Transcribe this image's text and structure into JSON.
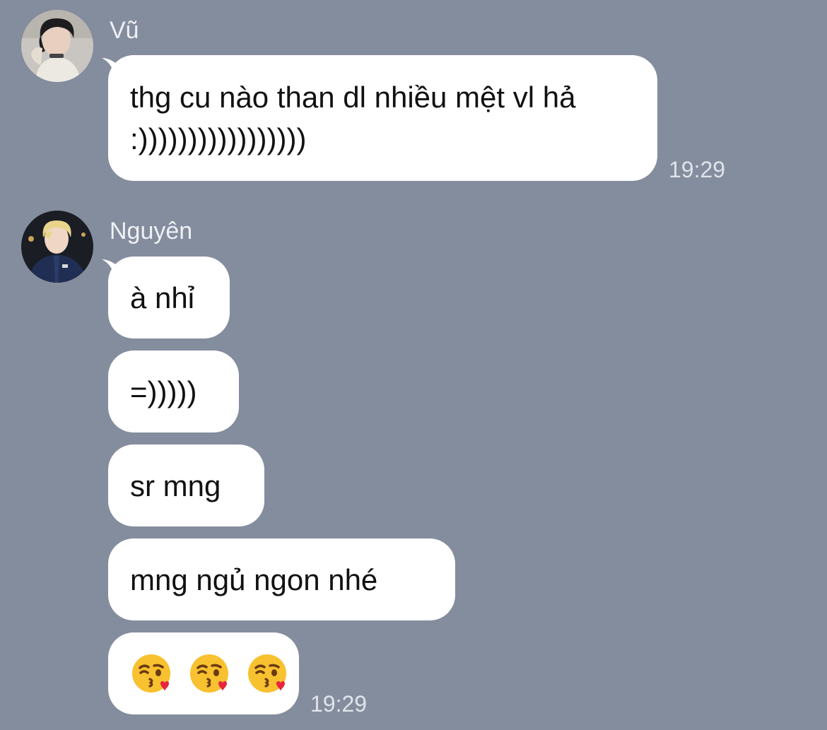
{
  "messages": [
    {
      "sender": "Vũ",
      "bubbles": [
        {
          "text": "thg cu nào than dl nhiều mệt vl hả :)))))))))))))))))"
        }
      ],
      "time": "19:29"
    },
    {
      "sender": "Nguyên",
      "bubbles": [
        {
          "text": "à nhỉ"
        },
        {
          "text": "=)))))"
        },
        {
          "text": "sr mng"
        },
        {
          "text": "mng ngủ ngon nhé"
        },
        {
          "emojis": [
            "kissing-face-with-heart-emoji",
            "kissing-face-with-heart-emoji",
            "kissing-face-with-heart-emoji"
          ]
        }
      ],
      "time": "19:29"
    }
  ],
  "colors": {
    "background": "#848d9e",
    "bubble": "#ffffff",
    "text": "#111111",
    "meta_text": "#eef0f4"
  }
}
